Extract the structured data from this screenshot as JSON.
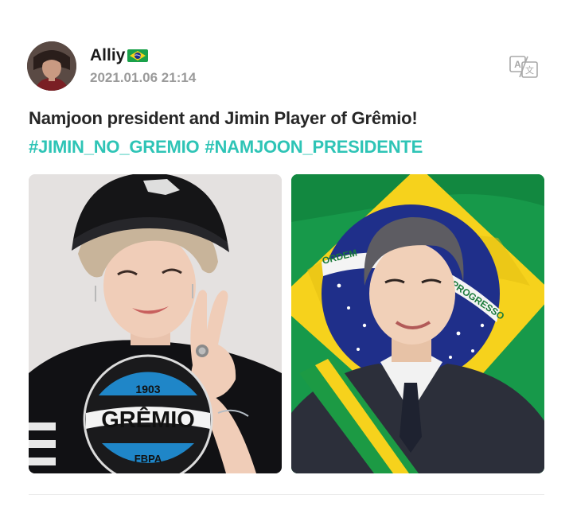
{
  "post": {
    "author": {
      "name": "Alliy",
      "flag_icon": "brazil-flag-icon",
      "timestamp": "2021.01.06 21:14"
    },
    "translate_icon": "translate-icon",
    "text": "Namjoon president and Jimin Player of Grêmio!",
    "hashtags": [
      "#JIMIN_NO_GREMIO",
      "#NAMJOON_PRESIDENTE"
    ],
    "images": {
      "left": {
        "shirt_badge": {
          "year": "1903",
          "club": "GRÊMIO",
          "abbr": "FBPA"
        }
      },
      "right": {
        "flag_lettering_top": "ORDEM",
        "flag_lettering_side": "PROGRESSO"
      }
    },
    "colors": {
      "hashtag": "#2ec4b6",
      "timestamp": "#9a9a9a",
      "brazil_green": "#1aa14a",
      "brazil_yellow": "#f6d21c",
      "brazil_blue": "#1f2f8a",
      "gremio_blue": "#1f86c8"
    }
  }
}
